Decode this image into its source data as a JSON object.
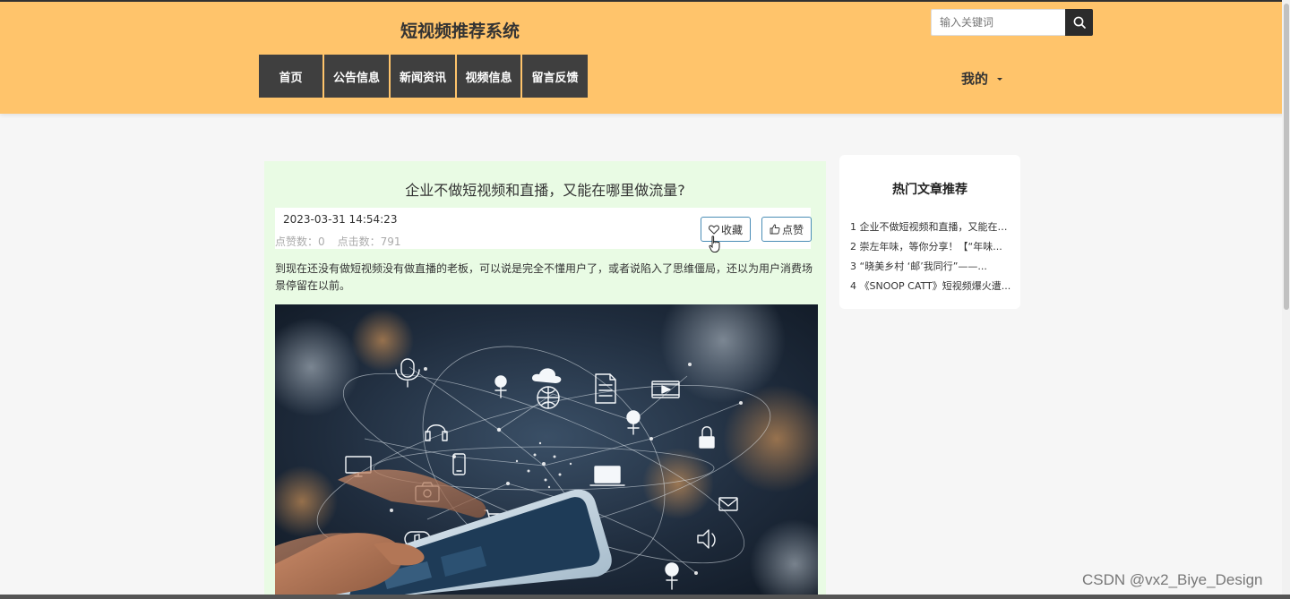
{
  "site": {
    "title": "短视频推荐系统"
  },
  "search": {
    "placeholder": "输入关键词",
    "icon": "search-icon"
  },
  "nav": {
    "items": [
      {
        "label": "首页"
      },
      {
        "label": "公告信息"
      },
      {
        "label": "新闻资讯"
      },
      {
        "label": "视频信息"
      },
      {
        "label": "留言反馈"
      }
    ]
  },
  "user_menu": {
    "label": "我的"
  },
  "article": {
    "title": "企业不做短视频和直播，又能在哪里做流量?",
    "datetime": "2023-03-31 14:54:23",
    "likes_label": "点赞数：0",
    "clicks_label": "点击数：791",
    "favorite_label": "收藏",
    "like_label": "点赞",
    "body": "到现在还没有做短视频没有做直播的老板，可以说是完全不懂用户了，或者说陷入了思维僵局，还以为用户消费场景停留在以前。"
  },
  "sidebar": {
    "title": "热门文章推荐",
    "items": [
      {
        "index": "1",
        "text": "企业不做短视频和直播，又能在哪里做流量?"
      },
      {
        "index": "2",
        "text": "崇左年味，等你分享！【“年味..."
      },
      {
        "index": "3",
        "text": "“晓美乡村 ‘邮’我同行”——..."
      },
      {
        "index": "4",
        "text": "《SNOOP CATT》短视频爆火遭..."
      }
    ]
  },
  "watermark": "CSDN @vx2_Biye_Design",
  "colors": {
    "header_bg": "#ffc46b",
    "nav_bg": "#3f3f3f",
    "article_bg": "#e9fbe4",
    "button_border": "#4a8db6"
  }
}
